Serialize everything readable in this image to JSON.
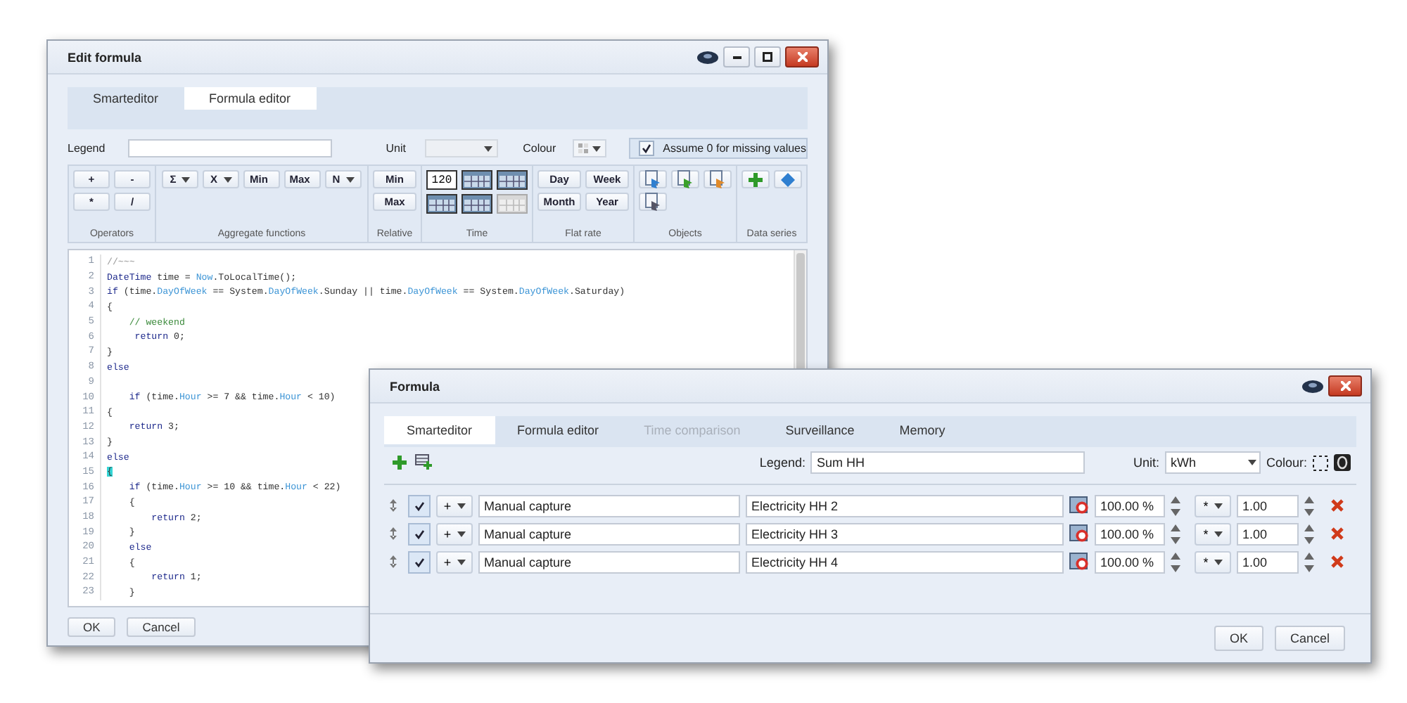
{
  "edit_window": {
    "title": "Edit formula",
    "tabs": [
      {
        "label": "Smarteditor",
        "selected": false
      },
      {
        "label": "Formula editor",
        "selected": true
      }
    ],
    "legend_label": "Legend",
    "unit_label": "Unit",
    "colour_label": "Colour",
    "assume_zero": {
      "label": "Assume 0 for missing values",
      "checked": true
    },
    "toolbar_groups": [
      {
        "label": "Operators",
        "kind": "buttons",
        "items": [
          "+",
          "-",
          "*",
          "/"
        ]
      },
      {
        "label": "Aggregate functions",
        "kind": "dropdowns",
        "items": [
          "Σ",
          "X",
          "Min",
          "Max",
          "N"
        ]
      },
      {
        "label": "Relative",
        "kind": "buttons",
        "items": [
          "Min",
          "Max"
        ]
      },
      {
        "label": "Time",
        "kind": "calendars",
        "counter": "120"
      },
      {
        "label": "Flat rate",
        "kind": "buttons",
        "items": [
          "Day",
          "Week",
          "Month",
          "Year"
        ]
      },
      {
        "label": "Objects",
        "kind": "objects"
      },
      {
        "label": "Data series",
        "kind": "series"
      }
    ],
    "code_lines": [
      {
        "number": "1",
        "tokens": [
          {
            "kind": "note",
            "text": "//~~~"
          }
        ]
      },
      {
        "number": "2",
        "tokens": [
          {
            "kind": "keyword",
            "text": "DateTime"
          },
          {
            "kind": "plain",
            "text": " time = "
          },
          {
            "kind": "member",
            "text": "Now"
          },
          {
            "kind": "plain",
            "text": ".ToLocalTime();"
          }
        ]
      },
      {
        "number": "3",
        "tokens": [
          {
            "kind": "keyword",
            "text": "if"
          },
          {
            "kind": "plain",
            "text": " (time."
          },
          {
            "kind": "member",
            "text": "DayOfWeek"
          },
          {
            "kind": "plain",
            "text": " == System."
          },
          {
            "kind": "member",
            "text": "DayOfWeek"
          },
          {
            "kind": "plain",
            "text": ".Sunday || time."
          },
          {
            "kind": "member",
            "text": "DayOfWeek"
          },
          {
            "kind": "plain",
            "text": " == System."
          },
          {
            "kind": "member",
            "text": "DayOfWeek"
          },
          {
            "kind": "plain",
            "text": ".Saturday)"
          }
        ]
      },
      {
        "number": "4",
        "tokens": [
          {
            "kind": "plain",
            "text": "{"
          }
        ]
      },
      {
        "number": "5",
        "tokens": [
          {
            "kind": "comment",
            "text": "    // weekend"
          }
        ]
      },
      {
        "number": "6",
        "tokens": [
          {
            "kind": "keyword",
            "text": "     return"
          },
          {
            "kind": "plain",
            "text": " 0;"
          }
        ]
      },
      {
        "number": "7",
        "tokens": [
          {
            "kind": "plain",
            "text": "}"
          }
        ]
      },
      {
        "number": "8",
        "tokens": [
          {
            "kind": "keyword",
            "text": "else"
          }
        ]
      },
      {
        "number": "9"
      },
      {
        "number": "10",
        "tokens": [
          {
            "kind": "keyword",
            "text": "    if"
          },
          {
            "kind": "plain",
            "text": " (time."
          },
          {
            "kind": "member",
            "text": "Hour"
          },
          {
            "kind": "plain",
            "text": " >= 7 && time."
          },
          {
            "kind": "member",
            "text": "Hour"
          },
          {
            "kind": "plain",
            "text": " < 10)"
          }
        ]
      },
      {
        "number": "11",
        "tokens": [
          {
            "kind": "plain",
            "text": "{"
          }
        ]
      },
      {
        "number": "12",
        "tokens": [
          {
            "kind": "keyword",
            "text": "    return"
          },
          {
            "kind": "plain",
            "text": " 3;"
          }
        ]
      },
      {
        "number": "13",
        "tokens": [
          {
            "kind": "plain",
            "text": "}"
          }
        ]
      },
      {
        "number": "14",
        "tokens": [
          {
            "kind": "keyword",
            "text": "else"
          }
        ]
      },
      {
        "number": "15",
        "tokens": [
          {
            "kind": "bracket_match",
            "text": "{"
          }
        ]
      },
      {
        "number": "16",
        "tokens": [
          {
            "kind": "keyword",
            "text": "    if"
          },
          {
            "kind": "plain",
            "text": " (time."
          },
          {
            "kind": "member",
            "text": "Hour"
          },
          {
            "kind": "plain",
            "text": " >= 10 && time."
          },
          {
            "kind": "member",
            "text": "Hour"
          },
          {
            "kind": "plain",
            "text": " < 22)"
          }
        ]
      },
      {
        "number": "17",
        "tokens": [
          {
            "kind": "plain",
            "text": "    {"
          }
        ]
      },
      {
        "number": "18",
        "tokens": [
          {
            "kind": "keyword",
            "text": "        return"
          },
          {
            "kind": "plain",
            "text": " 2;"
          }
        ]
      },
      {
        "number": "19",
        "tokens": [
          {
            "kind": "plain",
            "text": "    }"
          }
        ]
      },
      {
        "number": "20",
        "tokens": [
          {
            "kind": "keyword",
            "text": "    else"
          }
        ]
      },
      {
        "number": "21",
        "tokens": [
          {
            "kind": "plain",
            "text": "    {"
          }
        ]
      },
      {
        "number": "22",
        "tokens": [
          {
            "kind": "keyword",
            "text": "        return"
          },
          {
            "kind": "plain",
            "text": " 1;"
          }
        ]
      },
      {
        "number": "23",
        "tokens": [
          {
            "kind": "plain",
            "text": "    }"
          }
        ]
      }
    ],
    "buttons": [
      "OK",
      "Cancel"
    ]
  },
  "formula_window": {
    "title": "Formula",
    "tabs": [
      {
        "label": "Smarteditor",
        "selected": true,
        "disabled": false
      },
      {
        "label": "Formula editor",
        "selected": false,
        "disabled": false
      },
      {
        "label": "Time comparison",
        "selected": false,
        "disabled": true
      },
      {
        "label": "Surveillance",
        "selected": false,
        "disabled": false
      },
      {
        "label": "Memory",
        "selected": false,
        "disabled": false
      }
    ],
    "legend": {
      "label": "Legend:",
      "value": "Sum HH"
    },
    "unit": {
      "label": "Unit:",
      "value": "kWh"
    },
    "colour_label": "Colour:",
    "rows": [
      {
        "checked": true,
        "operator": "+",
        "source": "Manual capture",
        "series": "Electricity HH 2",
        "percentage": "100.00 %",
        "factor_operator": "*",
        "factor": "1.00"
      },
      {
        "checked": true,
        "operator": "+",
        "source": "Manual capture",
        "series": "Electricity HH 3",
        "percentage": "100.00 %",
        "factor_operator": "*",
        "factor": "1.00"
      },
      {
        "checked": true,
        "operator": "+",
        "source": "Manual capture",
        "series": "Electricity HH 4",
        "percentage": "100.00 %",
        "factor_operator": "*",
        "factor": "1.00"
      }
    ],
    "buttons": [
      "OK",
      "Cancel"
    ]
  }
}
